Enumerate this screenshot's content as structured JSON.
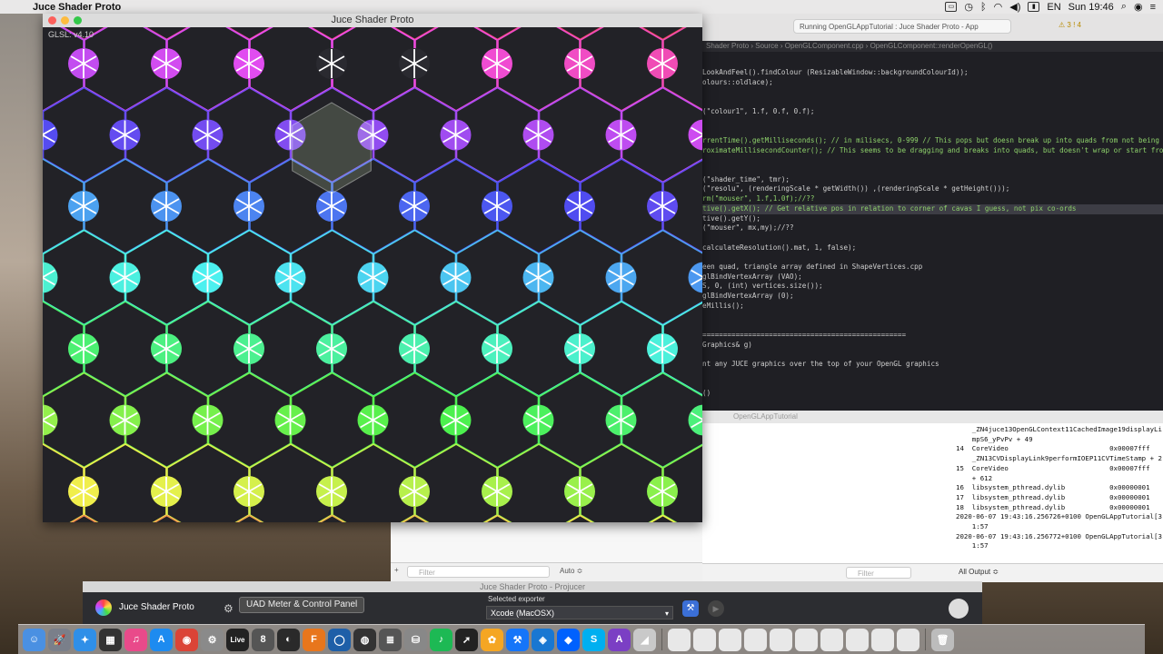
{
  "menubar": {
    "app_name": "Juce Shader Proto",
    "clock": "Sun 19:46",
    "icons": [
      "apple-icon",
      "display-icon",
      "time-machine-icon",
      "bluetooth-icon",
      "wifi-icon",
      "volume-icon",
      "battery-icon",
      "flag-icon",
      "search-icon",
      "siri-icon",
      "menu-icon"
    ],
    "flag_label": "EN"
  },
  "shader_window": {
    "title": "Juce Shader Proto",
    "glsl_label": "GLSL: v4.10"
  },
  "xcode": {
    "activity_text": "Running OpenGLAppTutorial : Juce Shader Proto - App",
    "warnings": "⚠ 3 ! 4",
    "breadcrumb": [
      "Shader Proto",
      "Source",
      "OpenGLComponent.cpp",
      "OpenGLComponent::renderOpenGL()"
    ],
    "code_lines": [
      "LookAndFeel().findColour (ResizableWindow::backgroundColourId));",
      "olours::oldlace);",
      "",
      "",
      "(\"colour1\", 1.f, 0.f, 0.f);",
      "",
      "",
      "rrentTime().getMilliseconds(); // in milisecs, 0-999 // This pops but doesn break up into quads from not being s",
      "roximateMillisecondCounter(); // This seems to be dragging and breaks into quads, but doesn't wrap or start from",
      "",
      "",
      "(\"shader_time\", tmr);",
      "(\"resolu\", (renderingScale * getWidth()) ,(renderingScale * getHeight()));",
      "rm(\"mouser\", 1.f,1.0f);//??",
      "tive().getX(); // Get relative pos in relation to corner of cavas I guess, not pix co-ords",
      "tive().getY();",
      "(\"mouser\", mx,my);//??",
      "",
      "calculateResolution().mat, 1, false);",
      "",
      "een quad, triangle array defined in ShapeVertices.cpp",
      "glBindVertexArray (VAO);",
      "S, 0, (int) vertices.size());",
      "glBindVertexArray (0);",
      "eMillis();",
      "",
      "",
      "=================================================",
      "Graphics& g)",
      "",
      "nt any JUCE graphics over the top of your OpenGL graphics",
      "",
      "",
      "()"
    ],
    "debug_target": "OpenGLAppTutorial",
    "console_lines": [
      "    _ZN4juce13OpenGLContext11CachedImage19displayLi",
      "    mpS6_yPvPv + 49",
      "14  CoreVideo                         0x00007fff",
      "    _ZN13CVDisplayLink9performIOEP11CVTimeStamp + 2",
      "15  CoreVideo                         0x00007fff",
      "    + 612",
      "16  libsystem_pthread.dylib           0x00000001",
      "17  libsystem_pthread.dylib           0x00000001",
      "18  libsystem_pthread.dylib           0x00000001",
      "2020-06-07 19:43:16.256726+0100 OpenGLAppTutorial[3",
      "    1:57",
      "2020-06-07 19:43:16.256772+0100 OpenGLAppTutorial[3",
      "    1:57"
    ],
    "filter_placeholder": "Filter",
    "auto_label": "Auto ≎",
    "all_output_label": "All Output ≎"
  },
  "projucer": {
    "title": "Juce Shader Proto - Projucer",
    "project_name": "Juce Shader Proto",
    "exporter_label": "Selected exporter",
    "exporter_value": "Xcode (MacOSX)"
  },
  "tooltip": "UAD Meter & Control Panel",
  "dock": [
    {
      "name": "finder",
      "color": "#4a90e2",
      "glyph": "☺"
    },
    {
      "name": "launchpad",
      "color": "#7a7f8a",
      "glyph": "🚀"
    },
    {
      "name": "safari",
      "color": "#2f8fe8",
      "glyph": "✦"
    },
    {
      "name": "calculator-widget",
      "color": "#333",
      "glyph": "▦"
    },
    {
      "name": "itunes",
      "color": "#e94a8a",
      "glyph": "♫"
    },
    {
      "name": "app-store",
      "color": "#1d8bf0",
      "glyph": "A"
    },
    {
      "name": "chrome",
      "color": "#db4437",
      "glyph": "◉"
    },
    {
      "name": "system-preferences",
      "color": "#8a8a8a",
      "glyph": "⚙"
    },
    {
      "name": "ableton-live",
      "color": "#222",
      "glyph": "Live"
    },
    {
      "name": "gear-app",
      "color": "#555",
      "glyph": "8"
    },
    {
      "name": "uad-meter",
      "color": "#2a2a2a",
      "glyph": "◐"
    },
    {
      "name": "fmod",
      "color": "#e8761c",
      "glyph": "F"
    },
    {
      "name": "circle-app",
      "color": "#1e5fa8",
      "glyph": "◯"
    },
    {
      "name": "davinci",
      "color": "#333",
      "glyph": "◍"
    },
    {
      "name": "notes-app",
      "color": "#555",
      "glyph": "≣"
    },
    {
      "name": "disk-utility",
      "color": "#888",
      "glyph": "⛁"
    },
    {
      "name": "spotify",
      "color": "#1db954",
      "glyph": "♪"
    },
    {
      "name": "arrow-app",
      "color": "#222",
      "glyph": "➚"
    },
    {
      "name": "photos",
      "color": "#f5a623",
      "glyph": "✿"
    },
    {
      "name": "xcode",
      "color": "#1575f9",
      "glyph": "⚒"
    },
    {
      "name": "instruments",
      "color": "#1977d2",
      "glyph": "◈"
    },
    {
      "name": "dropbox",
      "color": "#0061fe",
      "glyph": "◆"
    },
    {
      "name": "skype",
      "color": "#00aff0",
      "glyph": "S"
    },
    {
      "name": "affinity",
      "color": "#7b3fc4",
      "glyph": "A"
    },
    {
      "name": "preview",
      "color": "#c9c9c9",
      "glyph": "◢"
    },
    {
      "name": "doc-1",
      "color": "#e8e8e8",
      "glyph": ""
    },
    {
      "name": "doc-2",
      "color": "#e8e8e8",
      "glyph": ""
    },
    {
      "name": "doc-3",
      "color": "#e8e8e8",
      "glyph": ""
    },
    {
      "name": "doc-4",
      "color": "#e8e8e8",
      "glyph": ""
    },
    {
      "name": "doc-5",
      "color": "#e8e8e8",
      "glyph": ""
    },
    {
      "name": "doc-6",
      "color": "#e8e8e8",
      "glyph": ""
    },
    {
      "name": "doc-7",
      "color": "#e8e8e8",
      "glyph": ""
    },
    {
      "name": "doc-8",
      "color": "#e8e8e8",
      "glyph": ""
    },
    {
      "name": "doc-9",
      "color": "#e8e8e8",
      "glyph": ""
    },
    {
      "name": "doc-10",
      "color": "#e8e8e8",
      "glyph": ""
    },
    {
      "name": "trash",
      "color": "#bcbcbc",
      "glyph": "🗑"
    }
  ]
}
